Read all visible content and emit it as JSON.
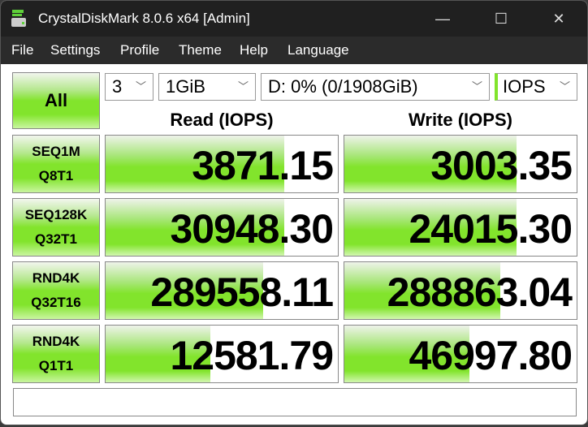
{
  "window": {
    "title": "CrystalDiskMark 8.0.6 x64 [Admin]",
    "minimize": "—",
    "maximize": "☐",
    "close": "✕"
  },
  "menu": [
    "File",
    "Settings",
    "Profile",
    "Theme",
    "Help",
    "Language"
  ],
  "controls": {
    "all_label": "All",
    "count": "3",
    "size": "1GiB",
    "drive": "D: 0% (0/1908GiB)",
    "unit": "IOPS"
  },
  "headers": {
    "read": "Read (IOPS)",
    "write": "Write (IOPS)"
  },
  "accent": "#82e42c",
  "rows": [
    {
      "l1": "SEQ1M",
      "l2": "Q8T1",
      "read": "3871.15",
      "write": "3003.35",
      "read_bar": 0.77,
      "write_bar": 0.74
    },
    {
      "l1": "SEQ128K",
      "l2": "Q32T1",
      "read": "30948.30",
      "write": "24015.30",
      "read_bar": 0.77,
      "write_bar": 0.74
    },
    {
      "l1": "RND4K",
      "l2": "Q32T16",
      "read": "289558.11",
      "write": "288863.04",
      "read_bar": 0.68,
      "write_bar": 0.67
    },
    {
      "l1": "RND4K",
      "l2": "Q1T1",
      "read": "12581.79",
      "write": "46997.80",
      "read_bar": 0.45,
      "write_bar": 0.54
    }
  ],
  "comment": ""
}
